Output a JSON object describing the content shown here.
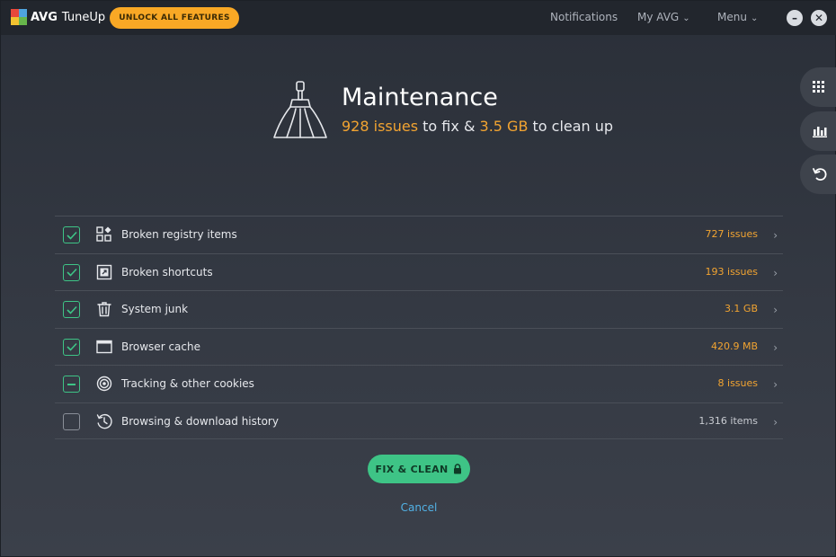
{
  "app": {
    "brand": "AVG",
    "product": "TuneUp",
    "unlock_label": "UNLOCK ALL FEATURES"
  },
  "nav": {
    "notifications": "Notifications",
    "my_avg": "My AVG",
    "menu": "Menu"
  },
  "header": {
    "title": "Maintenance",
    "issues_count": "928 issues",
    "mid_text": "to fix &",
    "size": "3.5 GB",
    "end_text": "to clean up"
  },
  "items": [
    {
      "label": "Broken registry items",
      "value": "727 issues",
      "state": "checked",
      "icon": "registry-icon",
      "value_style": "accent"
    },
    {
      "label": "Broken shortcuts",
      "value": "193 issues",
      "state": "checked",
      "icon": "shortcut-icon",
      "value_style": "accent"
    },
    {
      "label": "System junk",
      "value": "3.1 GB",
      "state": "checked",
      "icon": "trash-icon",
      "value_style": "accent"
    },
    {
      "label": "Browser cache",
      "value": "420.9 MB",
      "state": "checked",
      "icon": "browser-window-icon",
      "value_style": "accent"
    },
    {
      "label": "Tracking & other cookies",
      "value": "8 issues",
      "state": "partial",
      "icon": "target-icon",
      "value_style": "accent"
    },
    {
      "label": "Browsing & download history",
      "value": "1,316 items",
      "state": "unchecked",
      "icon": "history-icon",
      "value_style": "neutral"
    }
  ],
  "actions": {
    "fix_label": "FIX & CLEAN",
    "cancel_label": "Cancel"
  },
  "colors": {
    "accent": "#f2a431",
    "primary_green": "#3ec486",
    "unlock_orange": "#f9a825",
    "link_blue": "#52b2e6"
  }
}
